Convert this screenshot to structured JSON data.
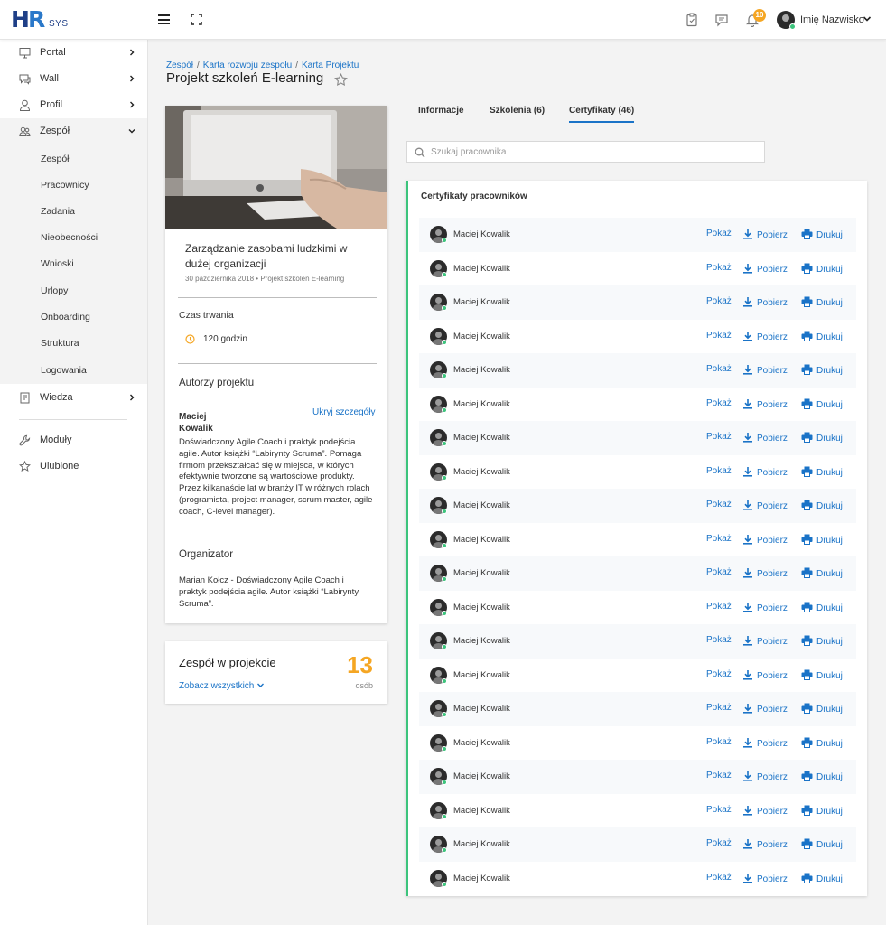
{
  "app": {
    "logo_main": "HR",
    "logo_sub": "SYS"
  },
  "topbar": {
    "notification_count": "10",
    "user_name": "Imię Nazwisko"
  },
  "sidebar": {
    "items": [
      {
        "label": "Portal",
        "icon": "monitor-icon"
      },
      {
        "label": "Wall",
        "icon": "chat-icon"
      },
      {
        "label": "Profil",
        "icon": "user-icon"
      },
      {
        "label": "Zespół",
        "icon": "team-icon"
      }
    ],
    "sub_items": [
      "Zespół",
      "Pracownicy",
      "Zadania",
      "Nieobecności",
      "Wnioski",
      "Urlopy",
      "Onboarding",
      "Struktura",
      "Logowania"
    ],
    "bottom_items": [
      {
        "label": "Wiedza",
        "icon": "book-icon"
      },
      {
        "label": "Moduły",
        "icon": "wrench-icon"
      },
      {
        "label": "Ulubione",
        "icon": "star-icon"
      }
    ]
  },
  "breadcrumb": [
    "Zespół",
    "Karta rozwoju zespołu",
    "Karta Projektu"
  ],
  "page_title": "Projekt szkoleń E-learning",
  "course": {
    "title": "Zarządzanie zasobami ludzkimi w dużej organizacji",
    "date": "30 października 2018",
    "project": "Projekt szkoleń E-learning",
    "duration_label": "Czas trwania",
    "duration": "120 godzin",
    "authors_label": "Autorzy projektu",
    "author_name": "Maciej Kowalik",
    "hide_details": "Ukryj szczegóły",
    "author_bio": "Doświadczony Agile Coach i praktyk podejścia agile. Autor książki “Labirynty Scruma”. Pomaga firmom przekształcać się w miejsca, w których efektywnie tworzone są wartościowe produkty. Przez kilkanaście lat w branży IT w różnych rolach (programista, project manager, scrum master, agile coach, C-level manager).",
    "organizer_label": "Organizator",
    "organizer_bio": "Marian Kołcz - Doświadczony Agile Coach i praktyk podejścia agile. Autor książki “Labirynty Scruma”."
  },
  "team": {
    "title": "Zespół w projekcie",
    "link": "Zobacz wszystkich",
    "count": "13",
    "unit": "osób"
  },
  "tabs": [
    {
      "label": "Informacje",
      "active": false
    },
    {
      "label": "Szkolenia (6)",
      "active": false
    },
    {
      "label": "Certyfikaty (46)",
      "active": true
    }
  ],
  "search": {
    "placeholder": "Szukaj pracownika",
    "value": ""
  },
  "certificates": {
    "title": "Certyfikaty pracowników",
    "actions": {
      "show": "Pokaż",
      "download": "Pobierz",
      "print": "Drukuj"
    },
    "rows": [
      "Maciej Kowalik",
      "Maciej Kowalik",
      "Maciej Kowalik",
      "Maciej Kowalik",
      "Maciej Kowalik",
      "Maciej Kowalik",
      "Maciej Kowalik",
      "Maciej Kowalik",
      "Maciej Kowalik",
      "Maciej Kowalik",
      "Maciej Kowalik",
      "Maciej Kowalik",
      "Maciej Kowalik",
      "Maciej Kowalik",
      "Maciej Kowalik",
      "Maciej Kowalik",
      "Maciej Kowalik",
      "Maciej Kowalik",
      "Maciej Kowalik",
      "Maciej Kowalik"
    ]
  },
  "colors": {
    "accent": "#1a73c7",
    "highlight": "#f5a623",
    "online": "#3cc47c"
  }
}
